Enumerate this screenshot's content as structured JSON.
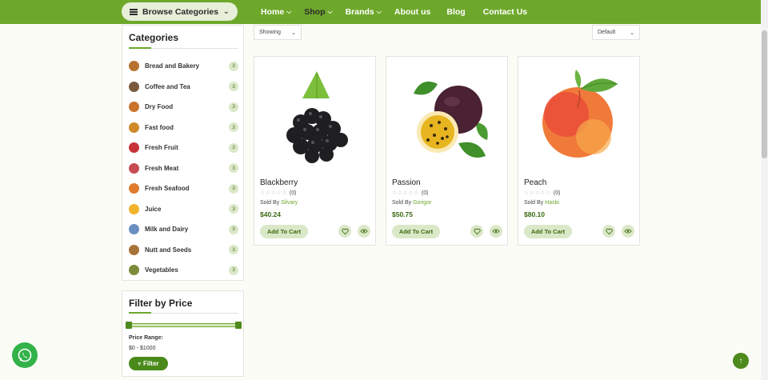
{
  "nav": {
    "browse_label": "Browse Categories",
    "items": [
      {
        "label": "Home",
        "dropdown": true
      },
      {
        "label": "Shop",
        "dropdown": true,
        "active": true
      },
      {
        "label": "Brands",
        "dropdown": true
      },
      {
        "label": "About us",
        "dropdown": false
      },
      {
        "label": "Blog",
        "dropdown": false
      },
      {
        "label": "Contact Us",
        "dropdown": false
      }
    ]
  },
  "sidebar": {
    "categories_title": "Categories",
    "categories": [
      {
        "name": "Bread and Bakery",
        "count": "3",
        "icon": "bread-icon",
        "color": "#b9732e"
      },
      {
        "name": "Coffee and Tea",
        "count": "3",
        "icon": "coffee-icon",
        "color": "#7a5a3e"
      },
      {
        "name": "Dry Food",
        "count": "3",
        "icon": "dry-food-icon",
        "color": "#c9732b"
      },
      {
        "name": "Fast food",
        "count": "3",
        "icon": "fast-food-icon",
        "color": "#d08a2a"
      },
      {
        "name": "Fresh Fruit",
        "count": "3",
        "icon": "fruit-icon",
        "color": "#c8323a"
      },
      {
        "name": "Fresh Meat",
        "count": "3",
        "icon": "meat-icon",
        "color": "#c84b52"
      },
      {
        "name": "Fresh Seafood",
        "count": "3",
        "icon": "seafood-icon",
        "color": "#e07b2d"
      },
      {
        "name": "Juice",
        "count": "3",
        "icon": "juice-icon",
        "color": "#f2b42c"
      },
      {
        "name": "Milk and Dairy",
        "count": "3",
        "icon": "milk-icon",
        "color": "#6b8fc2"
      },
      {
        "name": "Nutt and Seeds",
        "count": "3",
        "icon": "nuts-icon",
        "color": "#a8733b"
      },
      {
        "name": "Vegetables",
        "count": "3",
        "icon": "vegetables-icon",
        "color": "#7b8c3a"
      }
    ],
    "price_title": "Filter by Price",
    "price_range_label": "Price Range:",
    "price_range_value": "$0 - $1000",
    "range_min_fraction": 0,
    "range_max_fraction": 1,
    "filter_label": "Filter"
  },
  "toolbar": {
    "show_label": "Showing",
    "sort_label": "Default"
  },
  "products": [
    {
      "name": "Blackberry",
      "rating_count": "(0)",
      "sold_by": "Sold By",
      "vendor": "Silvary",
      "price": "$40.24",
      "cart_label": "Add To Cart"
    },
    {
      "name": "Passion",
      "rating_count": "(0)",
      "sold_by": "Sold By",
      "vendor": "Gorigor",
      "price": "$50.75",
      "cart_label": "Add To Cart"
    },
    {
      "name": "Peach",
      "rating_count": "(0)",
      "sold_by": "Sold By",
      "vendor": "Hasbi",
      "price": "$80.10",
      "cart_label": "Add To Cart"
    }
  ],
  "colors": {
    "brand_green": "#6ea82b",
    "dark_green": "#4a8a1a",
    "light_green": "#dbe8c8",
    "page_bg": "#fcfcf7"
  }
}
